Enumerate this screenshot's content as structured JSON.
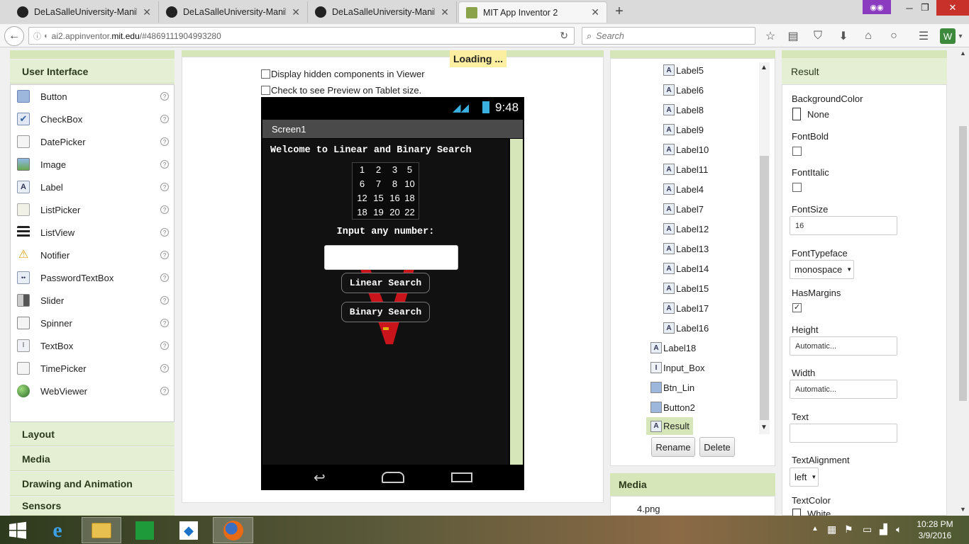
{
  "browser": {
    "tabs": [
      {
        "title": "DeLaSalleUniversity-Manil..."
      },
      {
        "title": "DeLaSalleUniversity-Manil..."
      },
      {
        "title": "DeLaSalleUniversity-Manil..."
      },
      {
        "title": "MIT App Inventor 2"
      }
    ],
    "url_prefix": "ai2.appinventor.",
    "url_domain": "mit.edu",
    "url_suffix": "/#4869111904993280",
    "search_placeholder": "Search"
  },
  "palette": {
    "section": "User Interface",
    "items": [
      {
        "label": "Button",
        "icon": "button-icon"
      },
      {
        "label": "CheckBox",
        "icon": "checkbox-icon"
      },
      {
        "label": "DatePicker",
        "icon": "datepicker-icon"
      },
      {
        "label": "Image",
        "icon": "image-icon"
      },
      {
        "label": "Label",
        "icon": "label-icon"
      },
      {
        "label": "ListPicker",
        "icon": "listpicker-icon"
      },
      {
        "label": "ListView",
        "icon": "listview-icon"
      },
      {
        "label": "Notifier",
        "icon": "notifier-icon"
      },
      {
        "label": "PasswordTextBox",
        "icon": "password-icon"
      },
      {
        "label": "Slider",
        "icon": "slider-icon"
      },
      {
        "label": "Spinner",
        "icon": "spinner-icon"
      },
      {
        "label": "TextBox",
        "icon": "textbox-icon"
      },
      {
        "label": "TimePicker",
        "icon": "timepicker-icon"
      },
      {
        "label": "WebViewer",
        "icon": "webviewer-icon"
      }
    ],
    "categories": [
      "Layout",
      "Media",
      "Drawing and Animation",
      "Sensors"
    ]
  },
  "viewer": {
    "loading": "Loading ...",
    "show_hidden": "Display hidden components in Viewer",
    "tablet_preview": "Check to see Preview on Tablet size.",
    "status_time": "9:48",
    "screen_title": "Screen1",
    "welcome": "Welcome to Linear and Binary Search",
    "grid": [
      [
        "1",
        "2",
        "3",
        "5"
      ],
      [
        "6",
        "7",
        "8",
        "10"
      ],
      [
        "12",
        "15",
        "16",
        "18"
      ],
      [
        "18",
        "19",
        "20",
        "22"
      ]
    ],
    "input_label": "Input any number:",
    "input_value": "",
    "linear_button": "Linear Search",
    "binary_button": "Binary Search"
  },
  "components": {
    "tree": [
      {
        "name": "Label5",
        "type": "label"
      },
      {
        "name": "Label6",
        "type": "label"
      },
      {
        "name": "Label8",
        "type": "label"
      },
      {
        "name": "Label9",
        "type": "label"
      },
      {
        "name": "Label10",
        "type": "label"
      },
      {
        "name": "Label11",
        "type": "label"
      },
      {
        "name": "Label4",
        "type": "label"
      },
      {
        "name": "Label7",
        "type": "label"
      },
      {
        "name": "Label12",
        "type": "label"
      },
      {
        "name": "Label13",
        "type": "label"
      },
      {
        "name": "Label14",
        "type": "label"
      },
      {
        "name": "Label15",
        "type": "label"
      },
      {
        "name": "Label17",
        "type": "label"
      },
      {
        "name": "Label16",
        "type": "label"
      },
      {
        "name": "Label18",
        "type": "label"
      },
      {
        "name": "Input_Box",
        "type": "textbox"
      },
      {
        "name": "Btn_Lin",
        "type": "button"
      },
      {
        "name": "Button2",
        "type": "button"
      },
      {
        "name": "Result",
        "type": "label"
      }
    ],
    "selected": "Result",
    "rename": "Rename",
    "delete": "Delete"
  },
  "media": {
    "header": "Media",
    "files": [
      "4.png"
    ]
  },
  "properties": {
    "selected": "Result",
    "background_color_label": "BackgroundColor",
    "background_color_value": "None",
    "font_bold_label": "FontBold",
    "font_bold": false,
    "font_italic_label": "FontItalic",
    "font_italic": false,
    "font_size_label": "FontSize",
    "font_size": "16",
    "font_typeface_label": "FontTypeface",
    "font_typeface": "monospace",
    "has_margins_label": "HasMargins",
    "has_margins": true,
    "height_label": "Height",
    "height_value": "Automatic...",
    "width_label": "Width",
    "width_value": "Automatic...",
    "text_label": "Text",
    "text_value": "",
    "text_alignment_label": "TextAlignment",
    "text_alignment": "left",
    "text_color_label": "TextColor",
    "text_color_value": "White"
  },
  "taskbar": {
    "time": "10:28 PM",
    "date": "3/9/2016"
  },
  "colors": {
    "accent": "#d7e6b8",
    "selected_tree": "#d7e6b8",
    "loading": "#fcefa1"
  }
}
